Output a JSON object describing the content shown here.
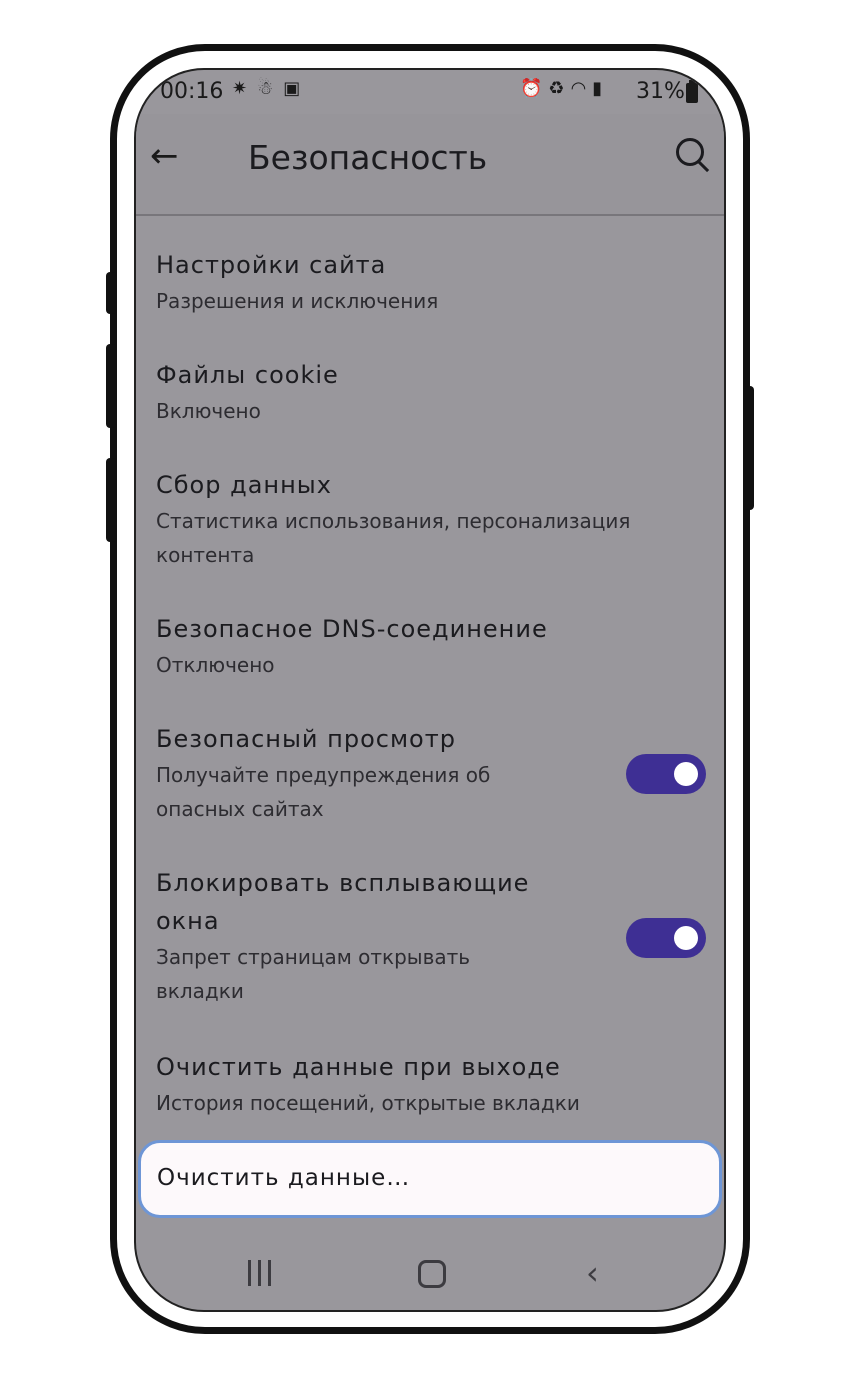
{
  "status_bar": {
    "time": "00:16",
    "left_icons": [
      "signal-burst-icon",
      "notification-icon",
      "image-icon"
    ],
    "right_icons": [
      "alarm-icon",
      "recycle-icon",
      "wifi-icon",
      "signal-icon"
    ],
    "battery_percent": "31%"
  },
  "app_bar": {
    "title": "Безопасность",
    "back_icon": "arrow-left-icon",
    "search_icon": "search-icon"
  },
  "settings": [
    {
      "title": "Настройки сайта",
      "subtitle": "Разрешения и исключения"
    },
    {
      "title": "Файлы cookie",
      "subtitle": "Включено"
    },
    {
      "title": "Сбор данных",
      "subtitle": "Статистика использования, персонализация контента"
    },
    {
      "title": "Безопасное DNS-соединение",
      "subtitle": "Отключено"
    },
    {
      "title": "Безопасный просмотр",
      "subtitle": "Получайте предупреждения об опасных сайтах",
      "toggle_on": true
    },
    {
      "title": "Блокировать всплывающие окна",
      "subtitle": "Запрет страницам открывать вкладки",
      "toggle_on": true
    },
    {
      "title": "Очистить данные при выходе",
      "subtitle": "История посещений, открытые вкладки"
    }
  ],
  "clear_button": {
    "label": "Очистить данные…"
  },
  "nav_bar": {
    "icons": [
      "recent-apps-icon",
      "home-icon",
      "back-icon"
    ]
  },
  "colors": {
    "accent": "#3e2f94",
    "screen_bg": "#99979c",
    "highlight_border": "#6e96d6"
  }
}
